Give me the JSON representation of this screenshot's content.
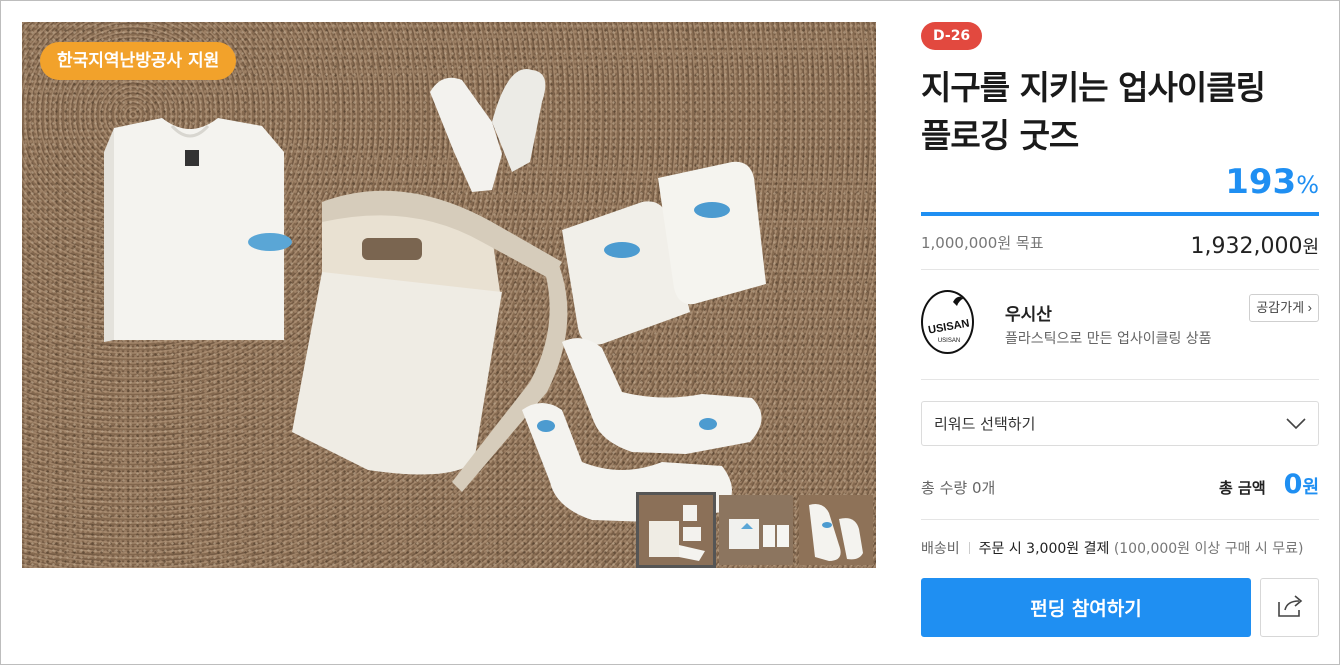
{
  "photo": {
    "support_badge": "한국지역난방공사 지원",
    "thumbnails": [
      "thumb-1",
      "thumb-2",
      "thumb-3"
    ],
    "active_thumbnail_index": 0
  },
  "campaign": {
    "dday": "D-26",
    "title_line1": "지구를 지키는 업사이클링",
    "title_line2": "플로깅 굿즈",
    "percent": "193",
    "percent_unit": "%",
    "goal": "1,000,000원 목표",
    "amount": "1,932,000",
    "amount_unit": "원"
  },
  "maker": {
    "name": "우시산",
    "description": "플라스틱으로 만든 업사이클링 상품",
    "logo_text": "USISAN",
    "logo_subtext": "USISAN",
    "empathy_button": "공감가게"
  },
  "reward": {
    "select_label": "리워드 선택하기"
  },
  "summary": {
    "qty_label": "총 수량",
    "qty_value": "0개",
    "total_label": "총 금액",
    "total_value": "0",
    "total_unit": "원"
  },
  "shipping": {
    "label": "배송비",
    "main": "주문 시 3,000원 결제",
    "note": "(100,000원 이상 구매 시 무료)"
  },
  "actions": {
    "fund_button": "펀딩 참여하기"
  },
  "colors": {
    "accent": "#1f8ff2",
    "badge": "#f2a22b",
    "dday": "#e2493f"
  }
}
